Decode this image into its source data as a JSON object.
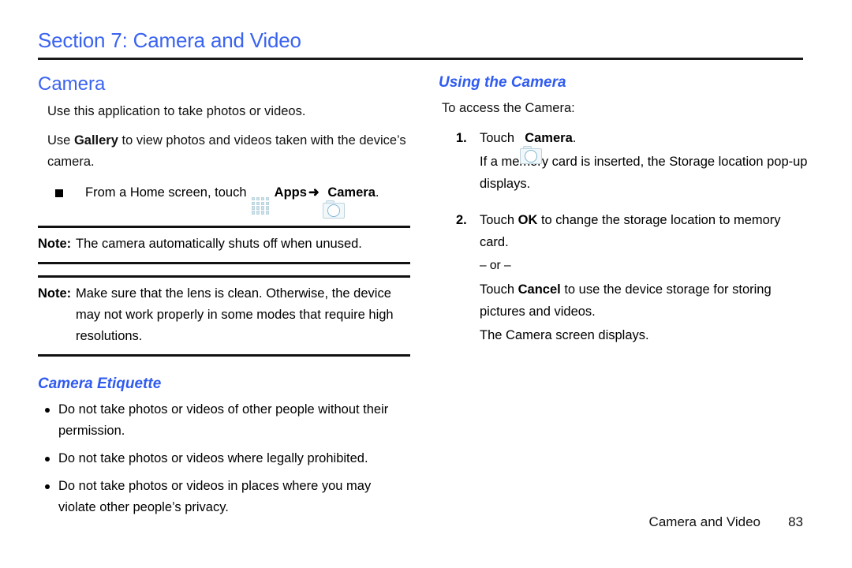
{
  "document": {
    "section_title": "Section 7: Camera and Video",
    "accent_color": "#3a63f0",
    "rule_color": "#111111"
  },
  "left_column": {
    "heading": "Camera",
    "intro_1": "Use this application to take photos or videos.",
    "intro_2_prefix": "Use ",
    "intro_2_bold": "Gallery",
    "intro_2_suffix": " to view photos and videos taken with the device’s camera.",
    "home_screen_item": {
      "bullet": "square-bullet",
      "text_before_apps": "From a Home screen, touch ",
      "apps_icon_name": "apps-grid-icon",
      "apps_label": "Apps",
      "arrow": "➜",
      "camera_icon_name": "camera-icon",
      "camera_label": "Camera",
      "text_after": "."
    },
    "notes": [
      {
        "label": "Note:",
        "text": "The camera automatically shuts off when unused."
      },
      {
        "label": "Note:",
        "text": "Make sure that the lens is clean. Otherwise, the device may not work properly in some modes that require high resolutions."
      }
    ],
    "etiquette": {
      "heading": "Camera Etiquette",
      "items": [
        "Do not take photos or videos of other people without their permission.",
        "Do not take photos or videos where legally prohibited.",
        "Do not take photos or videos in places where you may violate other people’s privacy."
      ]
    }
  },
  "right_column": {
    "heading": "Using the Camera",
    "intro": "To access the Camera:",
    "steps": [
      {
        "num": "1.",
        "touch_word": "Touch ",
        "icon_name": "camera-icon",
        "bold_target": "Camera",
        "after_bold": ".",
        "sub_paragraphs": [
          "If a memory card is inserted, the Storage location pop-up displays."
        ]
      },
      {
        "num": "2.",
        "touch_word": "Touch ",
        "bold_target": "OK",
        "after_bold": " to change the storage location to memory card.",
        "or_separator": "– or –",
        "alt_touch_word": "Touch ",
        "alt_bold_target": "Cancel",
        "alt_after_bold": " to use the device storage for storing pictures and videos.",
        "sub_paragraphs": [
          "The Camera screen displays."
        ]
      }
    ]
  },
  "footer": {
    "label": "Camera and Video",
    "page_number": "83"
  }
}
